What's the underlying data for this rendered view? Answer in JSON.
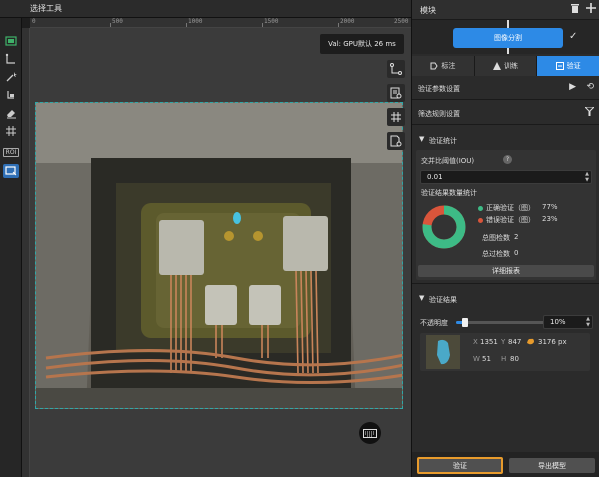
{
  "toolbar": {
    "title": "选择工具",
    "roi_label": "ROI"
  },
  "ruler": {
    "ticks": [
      "0",
      "500",
      "1000",
      "1500",
      "2000",
      "2500"
    ]
  },
  "canvas": {
    "val_readout": "Val:  GPU默认 26 ms"
  },
  "panel": {
    "header_title": "模块",
    "module_label": "图像分割",
    "tabs": [
      {
        "label": "标注",
        "icon": "tag-icon"
      },
      {
        "label": "训练",
        "icon": "train-icon"
      },
      {
        "label": "验证",
        "icon": "verify-icon"
      }
    ],
    "verify_params_label": "验证参数设置",
    "filter_rules_label": "筛选规则设置",
    "stats": {
      "section_title": "验证统计",
      "iou_label": "交并比阈值(IOU)",
      "iou_value": "0.01",
      "count_title": "验证结果数量统计",
      "correct_label": "正确验证（图）",
      "correct_pct": "77%",
      "wrong_label": "错误验证（图）",
      "wrong_pct": "23%",
      "total_label": "总图检数",
      "total_value": "2",
      "pass_label": "总过检数",
      "pass_value": "0",
      "detail_button": "详细报表",
      "correct_fraction": 0.77,
      "correct_color": "#3dbb86",
      "wrong_color": "#d9553b"
    },
    "results": {
      "section_title": "验证结果",
      "opacity_label": "不透明度",
      "opacity_value": "10%",
      "opacity_fraction": 0.1,
      "x_label": "X",
      "x_value": "1351",
      "y_label": "Y",
      "y_value": "847",
      "area_value": "3176 px",
      "w_label": "W",
      "w_value": "51",
      "h_label": "H",
      "h_value": "80"
    },
    "verify_button": "验证",
    "export_button": "导出模型"
  }
}
